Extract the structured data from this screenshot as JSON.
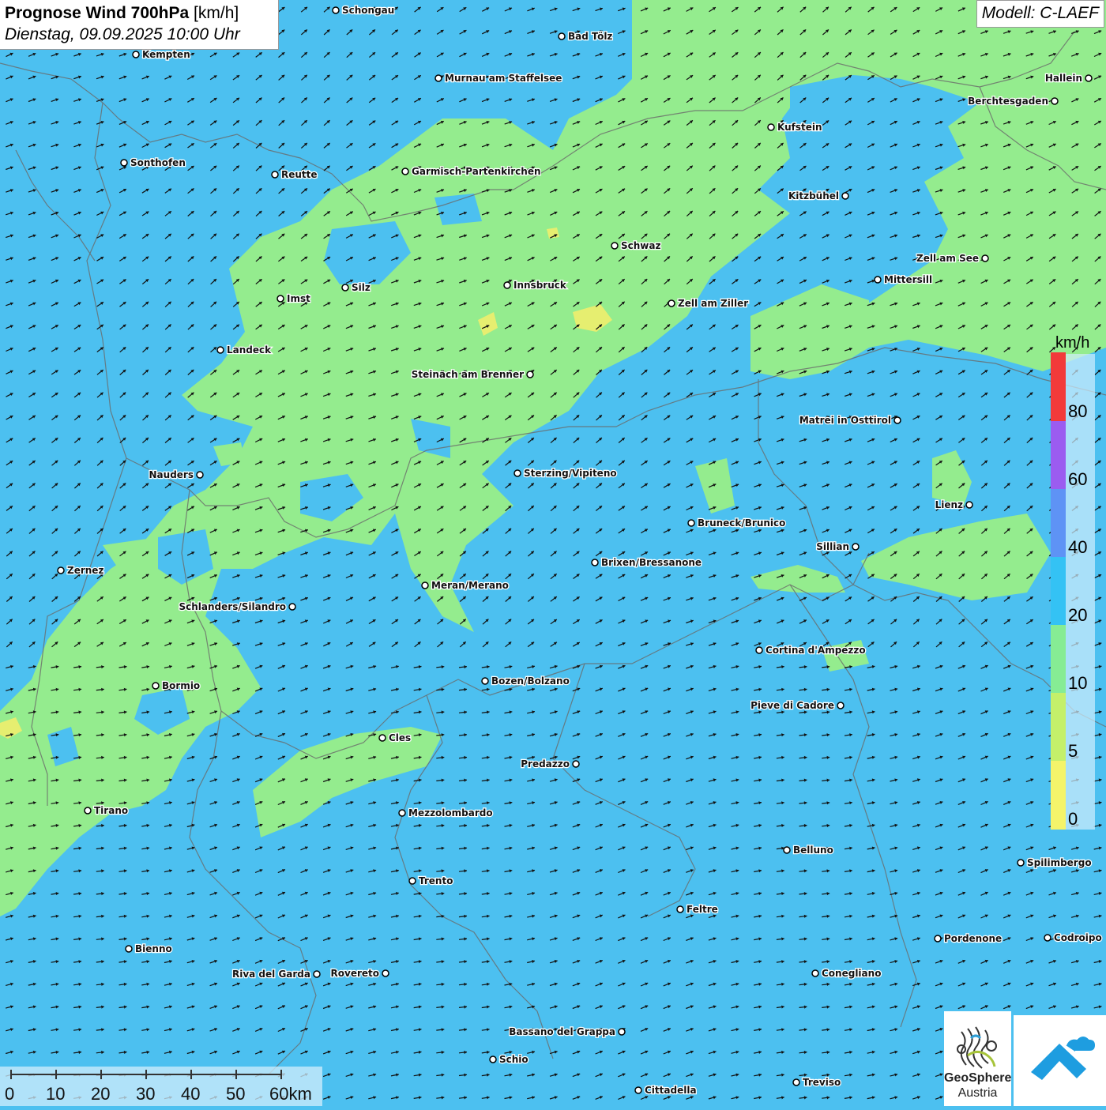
{
  "title": {
    "main": "Prognose Wind 700hPa",
    "unit": "[km/h]",
    "date": "Dienstag, 09.09.2025 10:00 Uhr"
  },
  "model": "Modell: C-LAEF",
  "legend": {
    "unit": "km/h",
    "labels": [
      "80",
      "60",
      "40",
      "20",
      "10",
      "5",
      "0"
    ],
    "bins": [
      {
        "color": "#f23a3a"
      },
      {
        "color": "#9b5cf0"
      },
      {
        "color": "#5e93f5"
      },
      {
        "color": "#34c2f4"
      },
      {
        "color": "#86ec94"
      },
      {
        "color": "#c4f06a"
      },
      {
        "color": "#f4f46a"
      }
    ]
  },
  "scale": {
    "labels": [
      "0",
      "10",
      "20",
      "30",
      "40",
      "50",
      "60km"
    ]
  },
  "logo": {
    "line1": "GeoSphere",
    "line2": "Austria"
  },
  "colors": {
    "field_blue": "#4cc0f0",
    "field_green": "#94ec8e",
    "field_yellow": "#e6ee70"
  },
  "cities": [
    {
      "name": "Schongau"
    },
    {
      "name": "Bad Tölz"
    },
    {
      "name": "Kempten"
    },
    {
      "name": "Murnau am Staffelsee"
    },
    {
      "name": "Hallein"
    },
    {
      "name": "Berchtesgaden"
    },
    {
      "name": "Kufstein"
    },
    {
      "name": "Sonthofen"
    },
    {
      "name": "Reutte"
    },
    {
      "name": "Garmisch-Partenkirchen"
    },
    {
      "name": "Kitzbühel"
    },
    {
      "name": "Schwaz"
    },
    {
      "name": "Zell am See"
    },
    {
      "name": "Innsbruck"
    },
    {
      "name": "Mittersill"
    },
    {
      "name": "Imst"
    },
    {
      "name": "Silz"
    },
    {
      "name": "Zell am Ziller"
    },
    {
      "name": "Landeck"
    },
    {
      "name": "Steinach am Brenner"
    },
    {
      "name": "Matrei in Osttirol"
    },
    {
      "name": "Nauders"
    },
    {
      "name": "Sterzing/Vipiteno"
    },
    {
      "name": "Lienz"
    },
    {
      "name": "Bruneck/Brunico"
    },
    {
      "name": "Sillian"
    },
    {
      "name": "Brixen/Bressanone"
    },
    {
      "name": "Zernez"
    },
    {
      "name": "Meran/Merano"
    },
    {
      "name": "Schlanders/Silandro"
    },
    {
      "name": "Cortina d'Ampezzo"
    },
    {
      "name": "Bozen/Bolzano"
    },
    {
      "name": "Bormio"
    },
    {
      "name": "Pieve di Cadore"
    },
    {
      "name": "Cles"
    },
    {
      "name": "Predazzo"
    },
    {
      "name": "Tirano"
    },
    {
      "name": "Mezzolombardo"
    },
    {
      "name": "Belluno"
    },
    {
      "name": "Spilimbergo"
    },
    {
      "name": "Trento"
    },
    {
      "name": "Feltre"
    },
    {
      "name": "Pordenone"
    },
    {
      "name": "Codroipo"
    },
    {
      "name": "Bienno"
    },
    {
      "name": "Riva del Garda"
    },
    {
      "name": "Rovereto"
    },
    {
      "name": "Conegliano"
    },
    {
      "name": "Bassano del Grappa"
    },
    {
      "name": "Schio"
    },
    {
      "name": "Treviso"
    },
    {
      "name": "Cittadella"
    }
  ]
}
